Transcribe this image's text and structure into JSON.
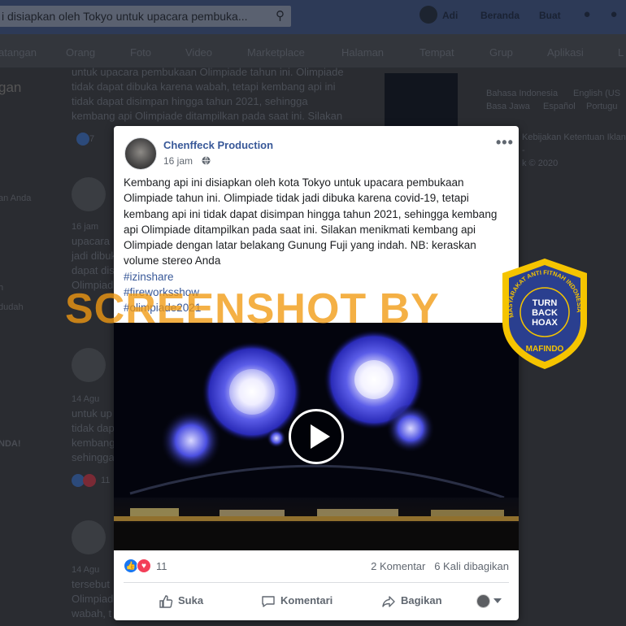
{
  "topbar": {
    "search_value": "i disiapkan oleh Tokyo untuk upacara pembuka...",
    "search_icon": "search-icon",
    "user": "Adi",
    "home": "Beranda",
    "create": "Buat"
  },
  "subnav": {
    "items": [
      "atangan",
      "Orang",
      "Foto",
      "Video",
      "Marketplace",
      "Halaman",
      "Tempat",
      "Grup",
      "Aplikasi",
      "L"
    ]
  },
  "left_column": {
    "heading": "gan",
    "item1": "an Anda",
    "item2": "h",
    "item3": "dudah",
    "item4": "NDA!"
  },
  "background_feed": {
    "post1_line1": "untuk upacara pembukaan Olimpiade tahun ini. Olimpiade",
    "post1_line2": "tidak dapat dibuka karena wabah, tetapi kembang api ini",
    "post1_line3": "tidak dapat disimpan hingga tahun 2021, sehingga",
    "post1_line4": "kembang api Olimpiade ditampilkan pada saat ini. Silakan",
    "post1_count": "7",
    "post2_date": "16 jam",
    "post2_l1": "upacara",
    "post2_l2": "jadi dibuk",
    "post2_l3": "dapat dis",
    "post2_l4": "Olimpiad",
    "post3_date": "14 Agu",
    "post3_l1": "untuk up",
    "post3_l2": "tidak dap",
    "post3_l3": "kembang",
    "post3_l4": "sehingga",
    "post3_count": "11",
    "post4_date": "14 Agu",
    "post4_l1": "tersebut",
    "post4_l2": "Olimpiad",
    "post4_l3": "wabah, t"
  },
  "right_column": {
    "lang1": "Bahasa Indonesia",
    "lang2": "English (US",
    "lang3": "Basa Jawa",
    "lang4": "Español",
    "lang5": "Portugu",
    "links": "Kebijakan  Ketentuan  Iklan  Pilih",
    "dash": "-",
    "copyright": "k © 2020"
  },
  "watermark": {
    "text": "SCREENSHOT BY"
  },
  "badge": {
    "arc_text": "MASYARAKAT ANTI FITNAH INDONESIA",
    "line1": "TURN",
    "line2": "BACK",
    "line3": "HOAX",
    "bottom": "MAFINDO"
  },
  "post": {
    "author": "Chenffeck Production",
    "time": "16 jam",
    "text": "Kembang api ini disiapkan oleh kota Tokyo untuk upacara pembukaan Olimpiade tahun ini. Olimpiade tidak jadi dibuka karena covid-19, tetapi kembang api ini tidak dapat disimpan hingga tahun 2021, sehingga kembang api Olimpiade ditampilkan pada saat ini. Silakan menikmati kembang api Olimpiade dengan latar belakang Gunung Fuji yang indah. NB: keraskan volume stereo Anda",
    "hashtags": [
      "#izinshare",
      "#fireworksshow",
      "#olimpiade2021"
    ],
    "reaction_count": "11",
    "comments": "2 Komentar",
    "shares": "6 Kali dibagikan",
    "actions": {
      "like": "Suka",
      "comment": "Komentari",
      "share": "Bagikan"
    },
    "colors": {
      "link": "#385898",
      "like": "#1877f2",
      "love": "#f33e58",
      "watermark": "#f29a12",
      "badge_blue": "#2a3f8f",
      "badge_gold": "#f5c400"
    }
  }
}
